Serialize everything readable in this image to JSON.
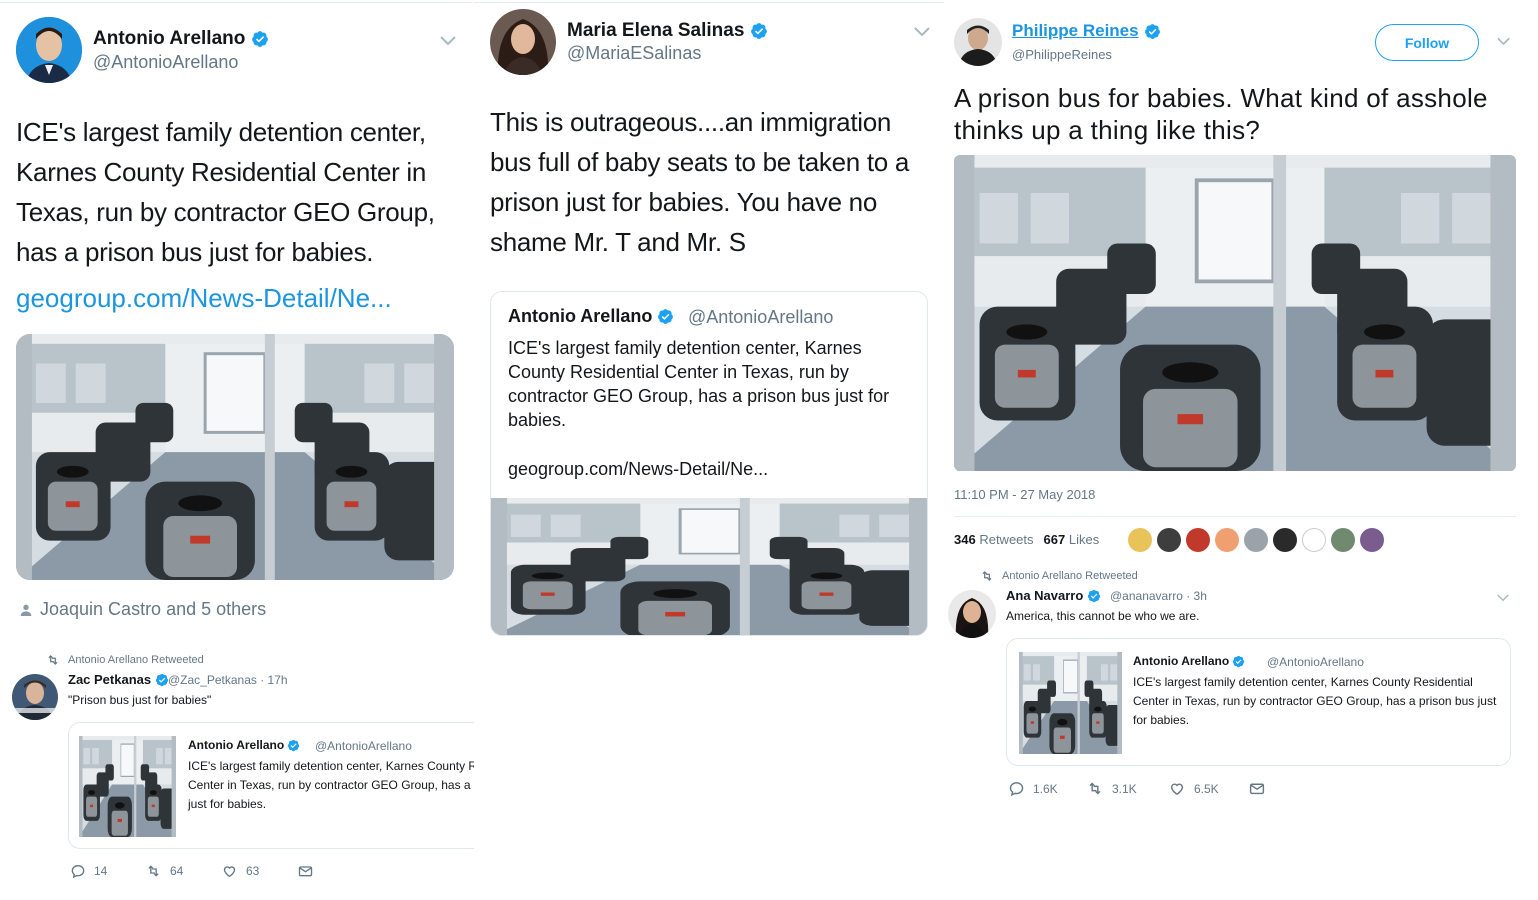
{
  "colors": {
    "link": "#1b95e0",
    "verified": "#1da1f2",
    "muted": "#657786",
    "text": "#14171a"
  },
  "col1": {
    "name": "Antonio Arellano",
    "handle": "@AntonioArellano",
    "text": "ICE's largest family detention center, Karnes County Residential Center in Texas, run by contractor GEO Group, has a prison bus just for babies.",
    "link": "geogroup.com/News-Detail/Ne...",
    "liked_by": "Joaquin Castro and 5 others",
    "retweet_note": "Antonio Arellano Retweeted",
    "sub": {
      "name": "Zac Petkanas",
      "handle_time": "@Zac_Petkanas · 17h",
      "text": "\"Prison bus just for babies\"",
      "quote_name": "Antonio Arellano",
      "quote_handle": "@AntonioArellano",
      "quote_text": "ICE's largest family detention center, Karnes County Residential Center in Texas, run by contractor GEO Group, has a prison bus just for babies.",
      "replies": "14",
      "retweets": "64",
      "likes": "63"
    }
  },
  "col2": {
    "name": "Maria Elena Salinas",
    "handle": "@MariaESalinas",
    "text": "This is outrageous....an immigration bus full of baby seats to be taken to a prison just for babies. You have no shame Mr. T and Mr. S",
    "quote_name": "Antonio Arellano",
    "quote_handle": "@AntonioArellano",
    "quote_text": "ICE's largest family detention center, Karnes County Residential Center in Texas, run by contractor GEO Group, has a prison bus just for babies.",
    "quote_link": "geogroup.com/News-Detail/Ne..."
  },
  "col3": {
    "name": "Philippe Reines",
    "handle": "@PhilippeReines",
    "follow_label": "Follow",
    "text": "A prison bus for babies. What kind of asshole thinks up a thing like this?",
    "timestamp": "11:10 PM - 27 May 2018",
    "retweets_count": "346",
    "retweets_label": "Retweets",
    "likes_count": "667",
    "likes_label": "Likes",
    "retweet_note": "Antonio Arellano Retweeted",
    "sub": {
      "name": "Ana Navarro",
      "handle_time": "@ananavarro · 3h",
      "text": "America, this cannot be who we are.",
      "quote_name": "Antonio Arellano",
      "quote_handle": "@AntonioArellano",
      "quote_text": "ICE's largest family detention center, Karnes County Residential Center in Texas, run by contractor GEO Group, has a prison bus just for babies.",
      "replies": "1.6K",
      "retweets": "3.1K",
      "likes": "6.5K"
    }
  }
}
